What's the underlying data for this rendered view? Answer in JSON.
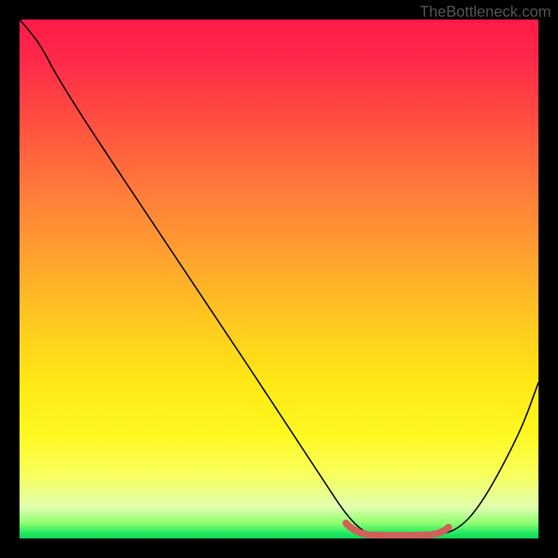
{
  "watermark": "TheBottleneck.com",
  "chart_data": {
    "type": "line",
    "title": "",
    "xlabel": "",
    "ylabel": "",
    "xlim": [
      0,
      100
    ],
    "ylim": [
      0,
      100
    ],
    "series": [
      {
        "name": "curve",
        "x": [
          0,
          5,
          12,
          20,
          28,
          36,
          44,
          52,
          58,
          62,
          66,
          70,
          74,
          78,
          82,
          88,
          94,
          100
        ],
        "y": [
          100,
          96,
          90,
          80,
          70,
          60,
          50,
          38,
          28,
          20,
          12,
          5,
          1,
          0.5,
          0.5,
          5,
          18,
          40
        ]
      }
    ],
    "highlight_range": {
      "x_start": 62,
      "x_end": 82,
      "color": "#d06058"
    },
    "gradient_stops": [
      {
        "pos": 0,
        "color": "#ff1a48"
      },
      {
        "pos": 50,
        "color": "#ffc820"
      },
      {
        "pos": 85,
        "color": "#fff820"
      },
      {
        "pos": 98,
        "color": "#20e860"
      }
    ]
  }
}
